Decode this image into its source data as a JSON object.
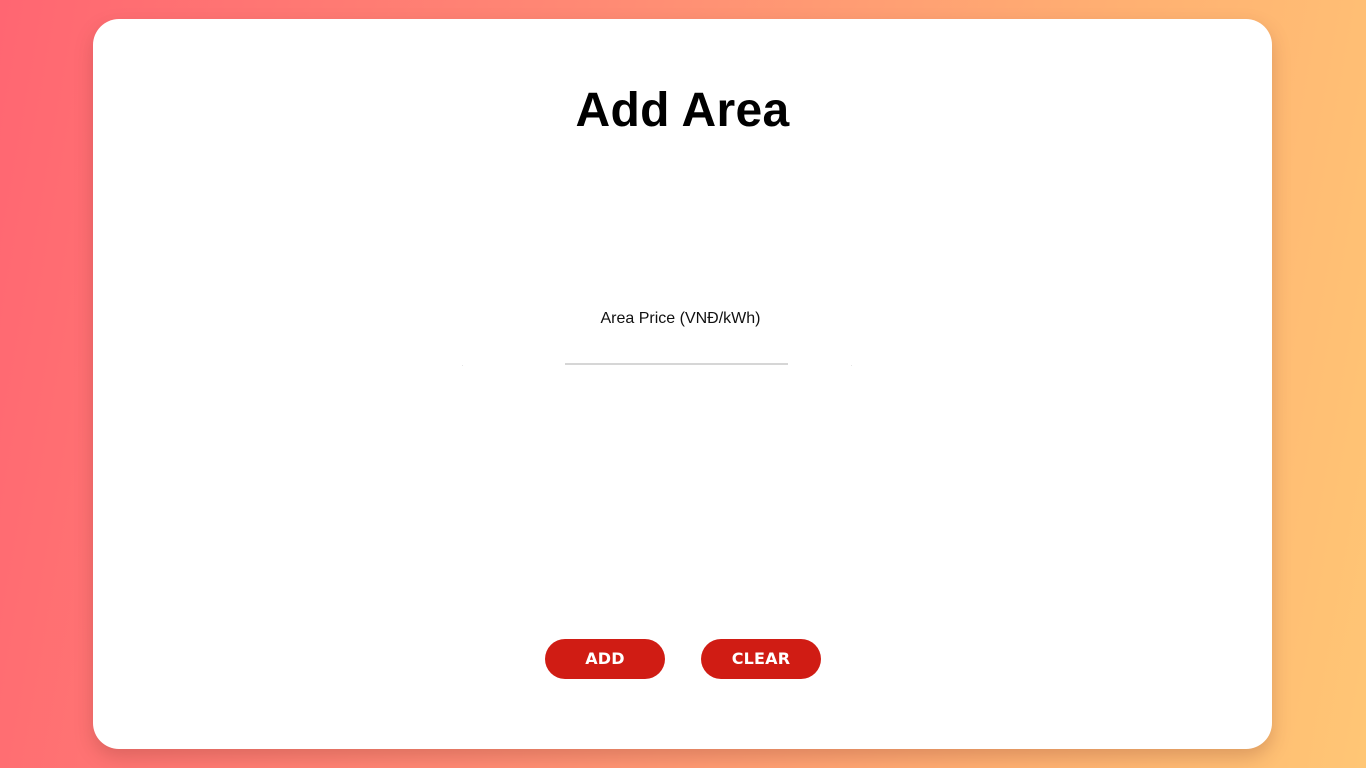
{
  "form": {
    "title": "Add Area",
    "price_label": "Area Price (VNĐ/kWh)",
    "price_value": ""
  },
  "buttons": {
    "add_label": "ADD",
    "clear_label": "CLEAR"
  },
  "colors": {
    "button_bg": "#d01c14",
    "gradient_start": "#ff6672",
    "gradient_end": "#ffc675",
    "card_bg": "#ffffff"
  }
}
